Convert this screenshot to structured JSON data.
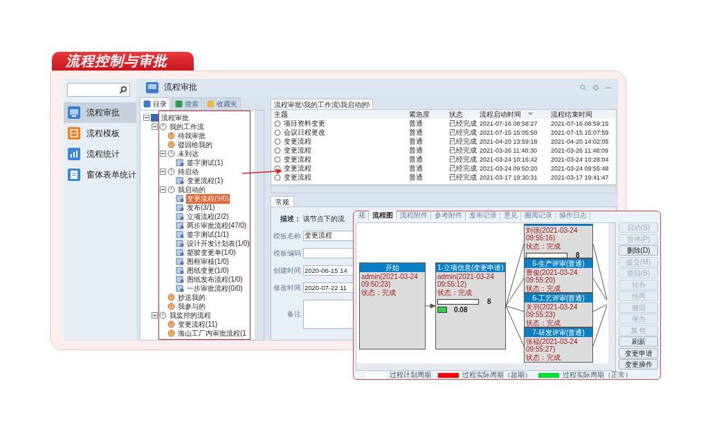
{
  "headline": "流程控制与审批",
  "sidebar": {
    "items": [
      {
        "label": "流程审批",
        "selected": true
      },
      {
        "label": "流程模板",
        "selected": false
      },
      {
        "label": "流程统计",
        "selected": false
      },
      {
        "label": "窗体表单统计",
        "selected": false
      }
    ]
  },
  "window": {
    "title": "流程审批"
  },
  "tree_tabs": [
    {
      "label": "目录",
      "selected": true
    },
    {
      "label": "搜索",
      "selected": false
    },
    {
      "label": "收藏夹",
      "selected": false
    }
  ],
  "tree": [
    {
      "label": "流程审批",
      "selected": false,
      "expanded": true,
      "children": [
        {
          "label": "我的工作流",
          "selected": false,
          "expanded": true,
          "children": [
            {
              "label": "待我审批",
              "selected": false
            },
            {
              "label": "驳回给我的",
              "selected": false
            },
            {
              "label": "未到达",
              "selected": false,
              "expanded": true,
              "children": [
                {
                  "label": "签字测试(1)",
                  "selected": false
                }
              ]
            },
            {
              "label": "待启动",
              "selected": false,
              "expanded": true,
              "children": [
                {
                  "label": "变更流程(1)",
                  "selected": false
                }
              ]
            },
            {
              "label": "我启动的",
              "selected": false,
              "expanded": true,
              "children": [
                {
                  "label": "变更流程(9/0)",
                  "selected": true
                },
                {
                  "label": "发布(3/1)",
                  "selected": false
                },
                {
                  "label": "立项流程(2/2)",
                  "selected": false
                },
                {
                  "label": "两步审批流程(47/0)",
                  "selected": false
                },
                {
                  "label": "签字测试(1/1)",
                  "selected": false
                },
                {
                  "label": "设计开发计划表(1/0)",
                  "selected": false
                },
                {
                  "label": "塑胶变更单(1/0)",
                  "selected": false
                },
                {
                  "label": "图框审核(1/0)",
                  "selected": false
                },
                {
                  "label": "图纸变更(1/0)",
                  "selected": false
                },
                {
                  "label": "图纸发布流程(1/0)",
                  "selected": false
                },
                {
                  "label": "一步审批流程(0/0)",
                  "selected": false
                }
              ]
            },
            {
              "label": "抄送我的",
              "selected": false
            },
            {
              "label": "我参与的",
              "selected": false
            }
          ]
        },
        {
          "label": "我监控的流程",
          "selected": false,
          "expanded": true,
          "children": [
            {
              "label": "变更流程(11)",
              "selected": false
            },
            {
              "label": "海山工厂内审批流程(1",
              "selected": false
            }
          ]
        }
      ]
    }
  ],
  "breadcrumb": "流程审批\\我的工作流\\我启动的\\",
  "table": {
    "columns": [
      {
        "label": "主题",
        "sorted": false
      },
      {
        "label": "紧急度",
        "sorted": false
      },
      {
        "label": "状态",
        "sorted": false
      },
      {
        "label": "流程启动时间",
        "sorted": true
      },
      {
        "label": "流程结束时间",
        "sorted": false
      }
    ],
    "rows": [
      {
        "selected": false,
        "cells": [
          "项目资料变更",
          "普通",
          "已经完成",
          "2021-07-16 08:58:27",
          "2021-07-16 08:59:15"
        ]
      },
      {
        "selected": false,
        "cells": [
          "会议日程更改",
          "普通",
          "已经完成",
          "2021-07-15 15:05:50",
          "2021-07-15 15:07:59"
        ]
      },
      {
        "selected": false,
        "cells": [
          "变更流程",
          "普通",
          "已经完成",
          "2021-04-20 13:59:18",
          "2021-04-20 14:02:05"
        ]
      },
      {
        "selected": false,
        "cells": [
          "变更流程",
          "普通",
          "已经完成",
          "2021-03-26 11:40:30",
          "2021-03-26 11:48:09"
        ]
      },
      {
        "selected": false,
        "cells": [
          "变更流程",
          "普通",
          "已经完成",
          "2021-03-24 10:16:42",
          "2021-03-24 10:28:04"
        ]
      },
      {
        "selected": false,
        "cells": [
          "变更流程",
          "普通",
          "已经完成",
          "2021-03-24 09:50:20",
          "2021-03-24 09:55:48"
        ]
      },
      {
        "selected": false,
        "cells": [
          "变更流程",
          "普通",
          "已经完成",
          "2021-03-17 19:30:31",
          "2021-03-17 19:41:47"
        ]
      }
    ]
  },
  "detail": {
    "tab": "常规",
    "description_label": "描述：",
    "description": "该节点下的流",
    "fields": [
      {
        "kind": "field",
        "label": "模板名称",
        "value": "变更流程"
      },
      {
        "kind": "field",
        "label": "模板编码"
      },
      {
        "kind": "field",
        "label": "创建时间",
        "value": "2020-06-15 14"
      },
      {
        "kind": "field",
        "label": "修改时间",
        "value": "2020-07-22 11"
      },
      {
        "kind": "textarea",
        "label": "备注"
      }
    ]
  },
  "popup": {
    "tabs": [
      {
        "label": "规",
        "selected": false
      },
      {
        "label": "流程图",
        "selected": true
      },
      {
        "label": "流程附件",
        "selected": false
      },
      {
        "label": "参考附件",
        "selected": false
      },
      {
        "label": "发布记录",
        "selected": false
      },
      {
        "label": "意见",
        "selected": false
      },
      {
        "label": "圈阅记录",
        "selected": false
      },
      {
        "label": "操作日志",
        "selected": false
      }
    ],
    "nodes": [
      {
        "title": "开始",
        "lines": [
          "admin(2021-03-24",
          "09:50:23)"
        ],
        "status": "状态：完成"
      },
      {
        "title": "1-立项信息(变更申请)",
        "lines": [
          "admin(2021-03-24",
          "09:55:12)"
        ],
        "status": "状态：完成",
        "plan_reading": "8",
        "actual_reading": "0.08"
      },
      {
        "lines": [
          "刘强(2021-03-24",
          "09:55:16)"
        ],
        "status": "状态：完成",
        "plan_reading": "8"
      },
      {
        "title": "6-生产评审(普通)",
        "lines": [
          "曹俊(2021-03-24",
          "09:55:20)"
        ],
        "status": "状态：完成"
      },
      {
        "title": "6-工艺评审(普通)",
        "lines": [
          "关羽(2021-03-24",
          "09:55:23)"
        ],
        "status": "状态：完成"
      },
      {
        "title": "7-研发评审(普通)",
        "lines": [
          "张福(2021-03-24",
          "09:55:27)"
        ],
        "status": "状态：完成"
      }
    ],
    "buttons": [
      {
        "label": "启动(S)",
        "disabled": true
      },
      {
        "label": "暂停(P)",
        "disabled": true
      },
      {
        "label": "删除(D)",
        "disabled": false
      },
      {
        "label": "提交(M)",
        "disabled": true
      },
      {
        "label": "驳回(B)",
        "disabled": true
      },
      {
        "label": "转办",
        "disabled": true
      },
      {
        "label": "传阅",
        "disabled": true
      },
      {
        "label": "撤回",
        "disabled": true
      },
      {
        "label": "催办",
        "disabled": true
      },
      {
        "label": "属 性",
        "disabled": true
      },
      {
        "label": "刷新",
        "disabled": false
      },
      {
        "label": "变更申请",
        "disabled": false
      },
      {
        "label": "变更操作",
        "disabled": false
      }
    ],
    "legend": [
      {
        "label": "过程计划周期",
        "color": "#ffffff"
      },
      {
        "label": "过程实际周期（超期）",
        "color": "#ff0000"
      },
      {
        "label": "过程实际周期（正常）",
        "color": "#00dd33"
      }
    ]
  }
}
